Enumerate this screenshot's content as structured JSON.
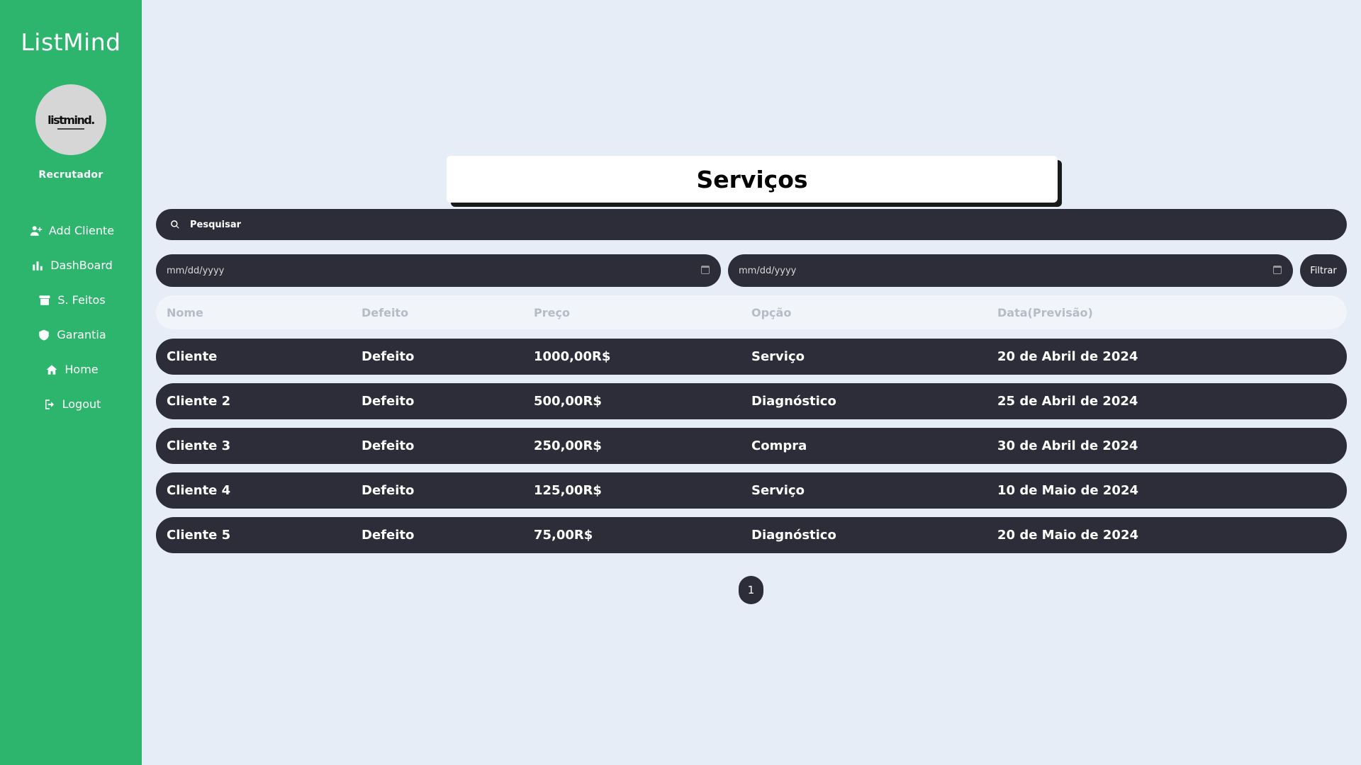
{
  "sidebar": {
    "brand": "ListMind",
    "logo_text": "listmind.",
    "role": "Recrutador",
    "items": [
      {
        "label": "Add Cliente",
        "icon": "user-plus-icon"
      },
      {
        "label": "DashBoard",
        "icon": "bar-chart-icon"
      },
      {
        "label": "S. Feitos",
        "icon": "archive-icon"
      },
      {
        "label": "Garantia",
        "icon": "shield-icon"
      },
      {
        "label": "Home",
        "icon": "home-icon"
      },
      {
        "label": "Logout",
        "icon": "logout-icon"
      }
    ]
  },
  "main": {
    "title": "Serviços",
    "search": {
      "placeholder": "Pesquisar",
      "icon": "search-icon"
    },
    "date_start": {
      "placeholder": "mm/dd/yyyy",
      "icon": "calendar-icon"
    },
    "date_end": {
      "placeholder": "mm/dd/yyyy",
      "icon": "calendar-icon"
    },
    "filter_label": "Filtrar",
    "table": {
      "columns": [
        "Nome",
        "Defeito",
        "Preço",
        "Opção",
        "Data(Previsão)"
      ],
      "rows": [
        [
          "Cliente",
          "Defeito",
          "1000,00R$",
          "Serviço",
          "20 de Abril de 2024"
        ],
        [
          "Cliente 2",
          "Defeito",
          "500,00R$",
          "Diagnóstico",
          "25 de Abril de 2024"
        ],
        [
          "Cliente 3",
          "Defeito",
          "250,00R$",
          "Compra",
          "30 de Abril de 2024"
        ],
        [
          "Cliente 4",
          "Defeito",
          "125,00R$",
          "Serviço",
          "10 de Maio de 2024"
        ],
        [
          "Cliente 5",
          "Defeito",
          "75,00R$",
          "Diagnóstico",
          "20 de Maio de 2024"
        ]
      ]
    },
    "pagination": {
      "current": "1"
    }
  },
  "colors": {
    "sidebar_bg": "#2db56e",
    "page_bg": "#e6edf7",
    "pill_dark": "#2c2d38",
    "header_text": "#b5bcc6"
  }
}
